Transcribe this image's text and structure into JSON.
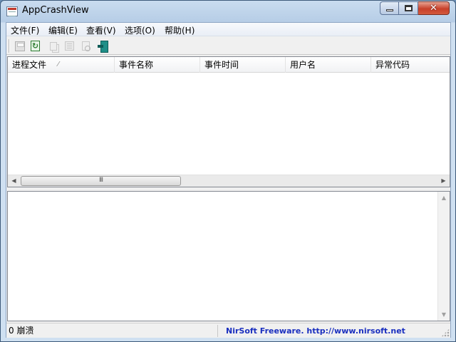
{
  "window": {
    "title": "AppCrashView"
  },
  "menu": [
    {
      "label": "文件(F)"
    },
    {
      "label": "编辑(E)"
    },
    {
      "label": "查看(V)"
    },
    {
      "label": "选项(O)"
    },
    {
      "label": "帮助(H)"
    }
  ],
  "toolbar": {
    "buttons": [
      {
        "icon": "save-icon",
        "enabled": false
      },
      {
        "icon": "refresh-icon",
        "enabled": true
      },
      {
        "icon": "copy-icon",
        "enabled": false
      },
      {
        "icon": "properties-icon",
        "enabled": false
      },
      {
        "icon": "find-icon",
        "enabled": false
      },
      {
        "icon": "exit-icon",
        "enabled": true
      }
    ]
  },
  "list": {
    "columns": [
      {
        "label": "进程文件",
        "sorted": true
      },
      {
        "label": "事件名称"
      },
      {
        "label": "事件时间"
      },
      {
        "label": "用户名"
      },
      {
        "label": "异常代码"
      }
    ],
    "rows": [],
    "scrollbar_thumb_glyph": "III"
  },
  "status": {
    "count_text": "0 崩溃",
    "credit_text": "NirSoft Freeware.  http://www.nirsoft.net"
  },
  "colors": {
    "link": "#1a2fbf",
    "close_button": "#c8402a"
  }
}
